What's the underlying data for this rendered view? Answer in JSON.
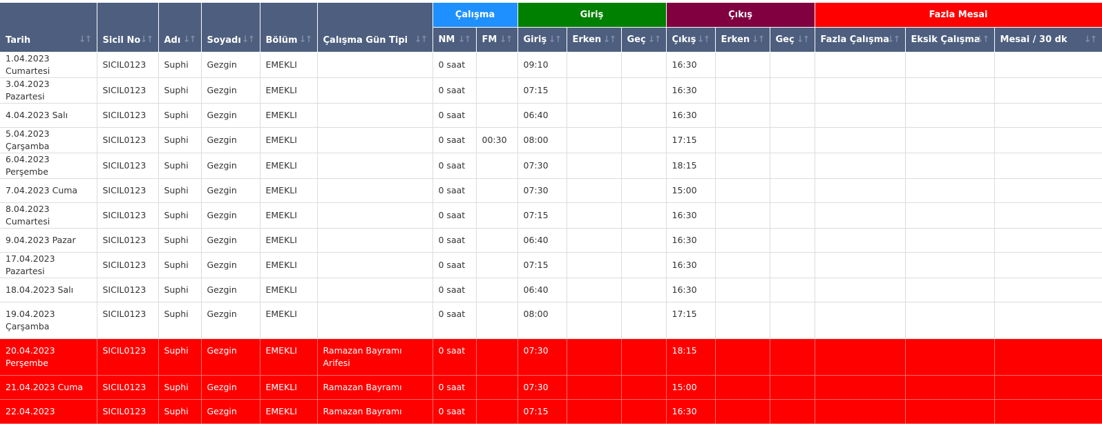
{
  "groups": {
    "calisma": {
      "label": "Çalışma",
      "color": "#1e90ff"
    },
    "giris": {
      "label": "Giriş",
      "color": "#008000"
    },
    "cikis": {
      "label": "Çıkış",
      "color": "#800040"
    },
    "fazla_mesai": {
      "label": "Fazla Mesai",
      "color": "#ff0000"
    }
  },
  "columns": {
    "tarih": "Tarih",
    "sicil_no": "Sicil No",
    "adi": "Adı",
    "soyadi": "Soyadı",
    "bolum": "Bölüm",
    "calisma_gun_tipi": "Çalışma Gün Tipi",
    "nm": "NM",
    "fm": "FM",
    "giris": "Giriş",
    "giris_erken": "Erken",
    "giris_gec": "Geç",
    "cikis": "Çıkış",
    "cikis_erken": "Erken",
    "cikis_gec": "Geç",
    "fazla_calisma": "Fazla Çalışma",
    "eksik_calisma": "Eksik Çalışma",
    "mesai_30dk": "Mesai / 30 dk"
  },
  "sort_icon": "sort-arrows-icon",
  "holiday_color": "#ff0000",
  "rows": [
    {
      "tarih": "1.04.2023 Cumartesi",
      "sicil": "SICIL0123",
      "adi": "Suphi",
      "soyadi": "Gezgin",
      "bolum": "EMEKLI",
      "gun_tipi": "",
      "nm": "0 saat",
      "fm": "",
      "giris": "09:10",
      "g_erken": "",
      "g_gec": "",
      "cikis": "16:30",
      "c_erken": "",
      "c_gec": "",
      "fazla": "",
      "eksik": "",
      "mesai": "",
      "holiday": false
    },
    {
      "tarih": "3.04.2023 Pazartesi",
      "sicil": "SICIL0123",
      "adi": "Suphi",
      "soyadi": "Gezgin",
      "bolum": "EMEKLI",
      "gun_tipi": "",
      "nm": "0 saat",
      "fm": "",
      "giris": "07:15",
      "g_erken": "",
      "g_gec": "",
      "cikis": "16:30",
      "c_erken": "",
      "c_gec": "",
      "fazla": "",
      "eksik": "",
      "mesai": "",
      "holiday": false
    },
    {
      "tarih": "4.04.2023 Salı",
      "sicil": "SICIL0123",
      "adi": "Suphi",
      "soyadi": "Gezgin",
      "bolum": "EMEKLI",
      "gun_tipi": "",
      "nm": "0 saat",
      "fm": "",
      "giris": "06:40",
      "g_erken": "",
      "g_gec": "",
      "cikis": "16:30",
      "c_erken": "",
      "c_gec": "",
      "fazla": "",
      "eksik": "",
      "mesai": "",
      "holiday": false
    },
    {
      "tarih": "5.04.2023 Çarşamba",
      "sicil": "SICIL0123",
      "adi": "Suphi",
      "soyadi": "Gezgin",
      "bolum": "EMEKLI",
      "gun_tipi": "",
      "nm": "0 saat",
      "fm": "00:30",
      "giris": "08:00",
      "g_erken": "",
      "g_gec": "",
      "cikis": "17:15",
      "c_erken": "",
      "c_gec": "",
      "fazla": "",
      "eksik": "",
      "mesai": "",
      "holiday": false
    },
    {
      "tarih": "6.04.2023 Perşembe",
      "sicil": "SICIL0123",
      "adi": "Suphi",
      "soyadi": "Gezgin",
      "bolum": "EMEKLI",
      "gun_tipi": "",
      "nm": "0 saat",
      "fm": "",
      "giris": "07:30",
      "g_erken": "",
      "g_gec": "",
      "cikis": "18:15",
      "c_erken": "",
      "c_gec": "",
      "fazla": "",
      "eksik": "",
      "mesai": "",
      "holiday": false
    },
    {
      "tarih": "7.04.2023 Cuma",
      "sicil": "SICIL0123",
      "adi": "Suphi",
      "soyadi": "Gezgin",
      "bolum": "EMEKLI",
      "gun_tipi": "",
      "nm": "0 saat",
      "fm": "",
      "giris": "07:30",
      "g_erken": "",
      "g_gec": "",
      "cikis": "15:00",
      "c_erken": "",
      "c_gec": "",
      "fazla": "",
      "eksik": "",
      "mesai": "",
      "holiday": false
    },
    {
      "tarih": "8.04.2023 Cumartesi",
      "sicil": "SICIL0123",
      "adi": "Suphi",
      "soyadi": "Gezgin",
      "bolum": "EMEKLI",
      "gun_tipi": "",
      "nm": "0 saat",
      "fm": "",
      "giris": "07:15",
      "g_erken": "",
      "g_gec": "",
      "cikis": "16:30",
      "c_erken": "",
      "c_gec": "",
      "fazla": "",
      "eksik": "",
      "mesai": "",
      "holiday": false
    },
    {
      "tarih": "9.04.2023 Pazar",
      "sicil": "SICIL0123",
      "adi": "Suphi",
      "soyadi": "Gezgin",
      "bolum": "EMEKLI",
      "gun_tipi": "",
      "nm": "0 saat",
      "fm": "",
      "giris": "06:40",
      "g_erken": "",
      "g_gec": "",
      "cikis": "16:30",
      "c_erken": "",
      "c_gec": "",
      "fazla": "",
      "eksik": "",
      "mesai": "",
      "holiday": false
    },
    {
      "tarih": "17.04.2023 Pazartesi",
      "sicil": "SICIL0123",
      "adi": "Suphi",
      "soyadi": "Gezgin",
      "bolum": "EMEKLI",
      "gun_tipi": "",
      "nm": "0 saat",
      "fm": "",
      "giris": "07:15",
      "g_erken": "",
      "g_gec": "",
      "cikis": "16:30",
      "c_erken": "",
      "c_gec": "",
      "fazla": "",
      "eksik": "",
      "mesai": "",
      "holiday": false
    },
    {
      "tarih": "18.04.2023 Salı",
      "sicil": "SICIL0123",
      "adi": "Suphi",
      "soyadi": "Gezgin",
      "bolum": "EMEKLI",
      "gun_tipi": "",
      "nm": "0 saat",
      "fm": "",
      "giris": "06:40",
      "g_erken": "",
      "g_gec": "",
      "cikis": "16:30",
      "c_erken": "",
      "c_gec": "",
      "fazla": "",
      "eksik": "",
      "mesai": "",
      "holiday": false
    },
    {
      "tarih": "19.04.2023 Çarşamba",
      "sicil": "SICIL0123",
      "adi": "Suphi",
      "soyadi": "Gezgin",
      "bolum": "EMEKLI",
      "gun_tipi": "",
      "nm": "0 saat",
      "fm": "",
      "giris": "08:00",
      "g_erken": "",
      "g_gec": "",
      "cikis": "17:15",
      "c_erken": "",
      "c_gec": "",
      "fazla": "",
      "eksik": "",
      "mesai": "",
      "holiday": false
    },
    {
      "tarih": "20.04.2023 Perşembe",
      "sicil": "SICIL0123",
      "adi": "Suphi",
      "soyadi": "Gezgin",
      "bolum": "EMEKLI",
      "gun_tipi": "Ramazan Bayramı Arifesi",
      "nm": "0 saat",
      "fm": "",
      "giris": "07:30",
      "g_erken": "",
      "g_gec": "",
      "cikis": "18:15",
      "c_erken": "",
      "c_gec": "",
      "fazla": "",
      "eksik": "",
      "mesai": "",
      "holiday": true
    },
    {
      "tarih": "21.04.2023 Cuma",
      "sicil": "SICIL0123",
      "adi": "Suphi",
      "soyadi": "Gezgin",
      "bolum": "EMEKLI",
      "gun_tipi": "Ramazan Bayramı",
      "nm": "0 saat",
      "fm": "",
      "giris": "07:30",
      "g_erken": "",
      "g_gec": "",
      "cikis": "15:00",
      "c_erken": "",
      "c_gec": "",
      "fazla": "",
      "eksik": "",
      "mesai": "",
      "holiday": true
    },
    {
      "tarih": "22.04.2023",
      "sicil": "SICIL0123",
      "adi": "Suphi",
      "soyadi": "Gezgin",
      "bolum": "EMEKLI",
      "gun_tipi": "Ramazan Bayramı",
      "nm": "0 saat",
      "fm": "",
      "giris": "07:15",
      "g_erken": "",
      "g_gec": "",
      "cikis": "16:30",
      "c_erken": "",
      "c_gec": "",
      "fazla": "",
      "eksik": "",
      "mesai": "",
      "holiday": true
    }
  ]
}
